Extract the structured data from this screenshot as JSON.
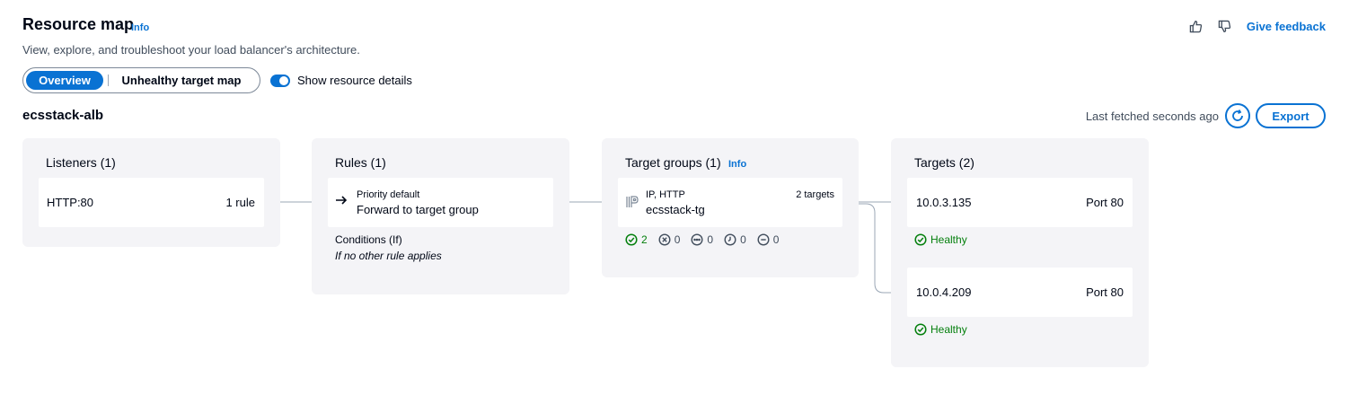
{
  "header": {
    "title": "Resource map",
    "info": "Info",
    "subtitle": "View, explore, and troubleshoot your load balancer's architecture.",
    "feedback_label": "Give feedback"
  },
  "view_tabs": [
    {
      "label": "Overview",
      "selected": true
    },
    {
      "label": "Unhealthy target map",
      "selected": false
    }
  ],
  "toggle": {
    "label": "Show resource details",
    "on": true
  },
  "load_balancer": {
    "name": "ecsstack-alb"
  },
  "toolbar": {
    "last_fetched": "Last fetched seconds ago",
    "export_label": "Export"
  },
  "listeners": {
    "title": "Listeners (1)",
    "items": [
      {
        "name": "HTTP:80",
        "rules": "1 rule"
      }
    ]
  },
  "rules": {
    "title": "Rules (1)",
    "items": [
      {
        "priority": "Priority default",
        "action": "Forward to target group"
      }
    ],
    "conditions_title": "Conditions (If)",
    "conditions_value": "If no other rule applies"
  },
  "target_groups": {
    "title": "Target groups (1)",
    "info": "Info",
    "items": [
      {
        "type": "IP, HTTP",
        "name": "ecsstack-tg",
        "count": "2 targets",
        "status_counts": {
          "healthy": "2",
          "unhealthy": "0",
          "unused": "0",
          "pending": "0",
          "draining": "0"
        }
      }
    ]
  },
  "targets": {
    "title": "Targets (2)",
    "items": [
      {
        "ip": "10.0.3.135",
        "port": "Port 80",
        "health": "Healthy"
      },
      {
        "ip": "10.0.4.209",
        "port": "Port 80",
        "health": "Healthy"
      }
    ]
  },
  "colors": {
    "accent": "#0972d3",
    "healthy": "#037f0c",
    "panel_bg": "#f4f4f7",
    "connector": "#9ba7b6"
  }
}
